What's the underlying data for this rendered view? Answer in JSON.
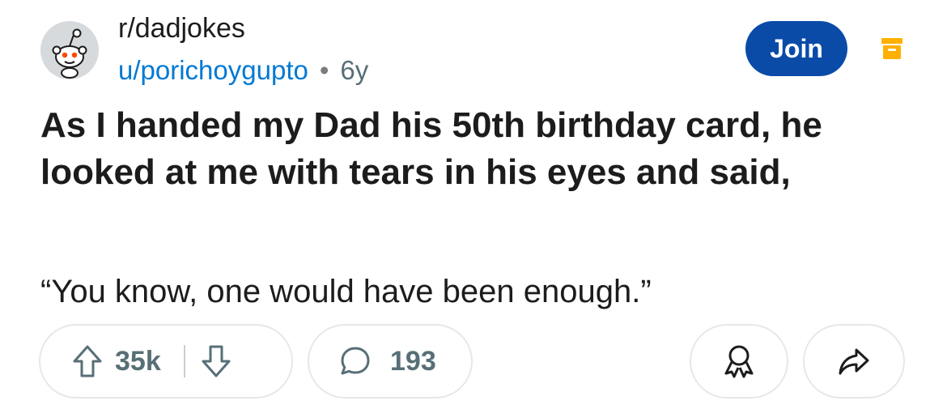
{
  "header": {
    "subreddit": "r/dadjokes",
    "author": "u/porichoygupto",
    "separator": "•",
    "age": "6y",
    "join_label": "Join"
  },
  "post": {
    "title": "As I handed my Dad his 50th birthday card, he looked at me with tears in his eyes and said,",
    "body": "“You know, one would have been enough.”"
  },
  "actions": {
    "upvotes": "35k",
    "comments": "193",
    "upvote_icon": "arrow-up-icon",
    "downvote_icon": "arrow-down-icon",
    "comment_icon": "speech-bubble-icon",
    "award_icon": "award-ribbon-icon",
    "share_icon": "share-arrow-icon"
  },
  "colors": {
    "join_bg": "#0a4ba8",
    "author": "#0079d3",
    "archive": "#ffb000",
    "meta": "#576f76"
  }
}
